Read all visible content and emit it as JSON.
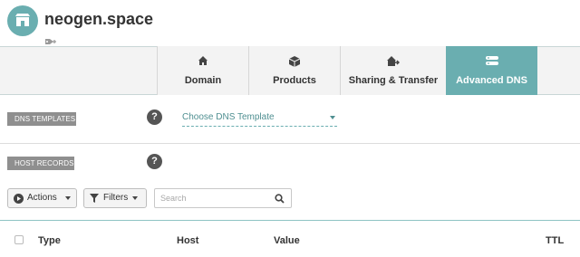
{
  "header": {
    "domain": "neogen.space",
    "store_icon": "storefront-icon",
    "tag_icon": "tag-add-icon"
  },
  "tabs": [
    {
      "label": "Domain",
      "icon": "home-icon",
      "active": false
    },
    {
      "label": "Products",
      "icon": "box-icon",
      "active": false
    },
    {
      "label": "Sharing & Transfer",
      "icon": "house-transfer-icon",
      "active": false
    },
    {
      "label": "Advanced DNS",
      "icon": "server-icon",
      "active": true
    }
  ],
  "dns_templates": {
    "label": "DNS TEMPLATES",
    "help": "?",
    "select_value": "Choose DNS Template"
  },
  "host_records": {
    "label": "HOST RECORDS",
    "help": "?"
  },
  "toolbar": {
    "actions_label": "Actions",
    "filters_label": "Filters",
    "search_placeholder": "Search"
  },
  "table": {
    "columns": [
      "Type",
      "Host",
      "Value",
      "TTL"
    ]
  },
  "colors": {
    "accent": "#6aaeb0",
    "label_bg": "#8f8f8f"
  }
}
